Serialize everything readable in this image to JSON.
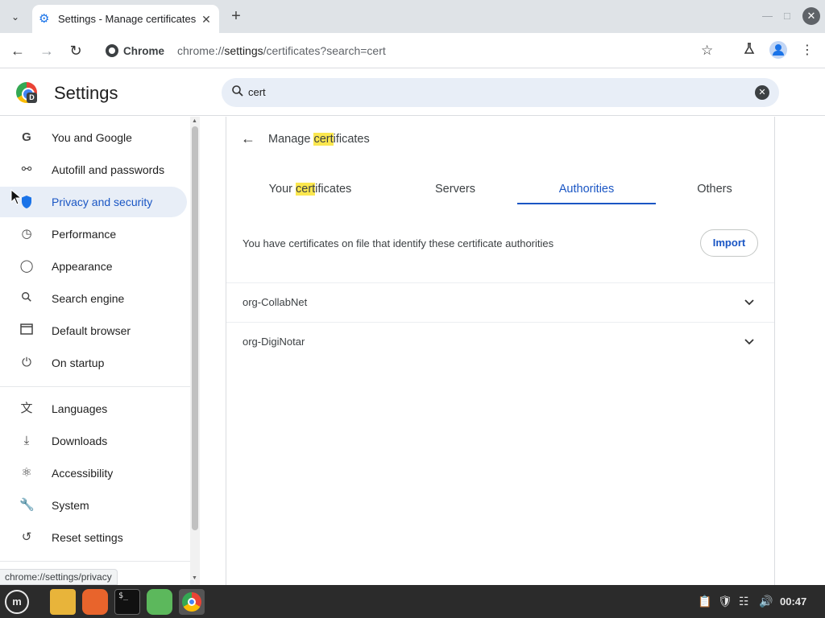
{
  "browser": {
    "tab_title": "Settings - Manage certificates",
    "url_chip": "Chrome",
    "url_prefix": "chrome://",
    "url_host": "settings",
    "url_rest": "/certificates?search=cert",
    "status_url": "chrome://settings/privacy"
  },
  "settings": {
    "title": "Settings",
    "search_value": "cert",
    "search_icon": "search-icon"
  },
  "sidebar": {
    "items": [
      {
        "label": "You and Google",
        "icon": "google-icon"
      },
      {
        "label": "Autofill and passwords",
        "icon": "key-icon"
      },
      {
        "label": "Privacy and security",
        "icon": "shield-icon",
        "active": true
      },
      {
        "label": "Performance",
        "icon": "speedometer-icon"
      },
      {
        "label": "Appearance",
        "icon": "palette-icon"
      },
      {
        "label": "Search engine",
        "icon": "search-icon"
      },
      {
        "label": "Default browser",
        "icon": "browser-window-icon"
      },
      {
        "label": "On startup",
        "icon": "power-icon"
      },
      {
        "label": "Languages",
        "icon": "translate-icon"
      },
      {
        "label": "Downloads",
        "icon": "download-icon"
      },
      {
        "label": "Accessibility",
        "icon": "accessibility-icon"
      },
      {
        "label": "System",
        "icon": "wrench-icon"
      },
      {
        "label": "Reset settings",
        "icon": "reset-icon"
      }
    ]
  },
  "certificates": {
    "title_prefix": "Manage ",
    "title_highlight": "cert",
    "title_suffix": "ificates",
    "tabs": [
      {
        "prefix": "Your ",
        "highlight": "cert",
        "suffix": "ificates"
      },
      {
        "label": "Servers"
      },
      {
        "label": "Authorities",
        "selected": true
      },
      {
        "label": "Others"
      }
    ],
    "info_text": "You have certificates on file that identify these certificate authorities",
    "import_label": "Import",
    "rows": [
      "org-CollabNet",
      "org-DigiNotar"
    ]
  },
  "taskbar": {
    "clock": "00:47"
  },
  "colors": {
    "accent": "#1a56c4",
    "highlight": "#fbe74f",
    "active_bg": "#e8eef7"
  }
}
